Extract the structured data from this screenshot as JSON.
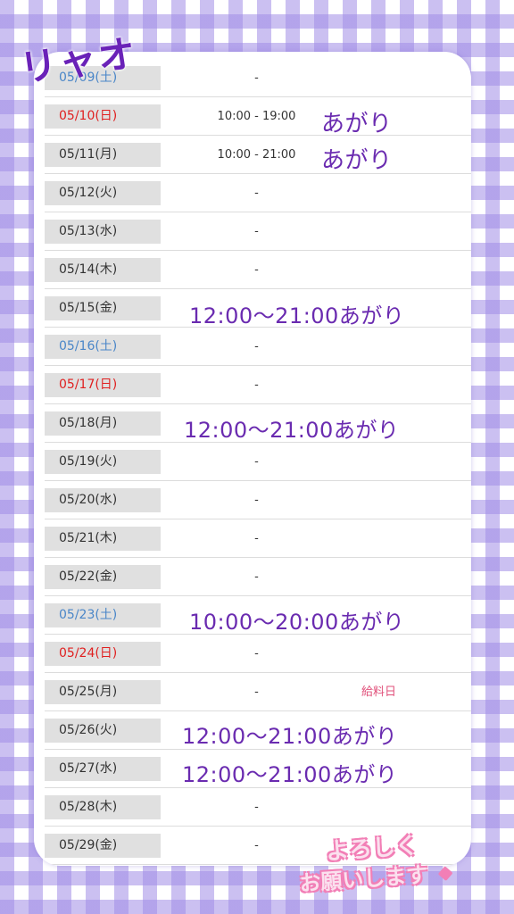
{
  "name_label": "リャオ",
  "schedule": [
    {
      "date": "05/09(土)",
      "day_type": "sat",
      "time": "-",
      "note": ""
    },
    {
      "date": "05/10(日)",
      "day_type": "sun",
      "time": "10:00 - 19:00",
      "note": ""
    },
    {
      "date": "05/11(月)",
      "day_type": "weekday",
      "time": "10:00 - 21:00",
      "note": ""
    },
    {
      "date": "05/12(火)",
      "day_type": "weekday",
      "time": "-",
      "note": ""
    },
    {
      "date": "05/13(水)",
      "day_type": "weekday",
      "time": "-",
      "note": ""
    },
    {
      "date": "05/14(木)",
      "day_type": "weekday",
      "time": "-",
      "note": ""
    },
    {
      "date": "05/15(金)",
      "day_type": "weekday",
      "time": "",
      "note": ""
    },
    {
      "date": "05/16(土)",
      "day_type": "sat",
      "time": "-",
      "note": ""
    },
    {
      "date": "05/17(日)",
      "day_type": "sun",
      "time": "-",
      "note": ""
    },
    {
      "date": "05/18(月)",
      "day_type": "weekday",
      "time": "",
      "note": ""
    },
    {
      "date": "05/19(火)",
      "day_type": "weekday",
      "time": "-",
      "note": ""
    },
    {
      "date": "05/20(水)",
      "day_type": "weekday",
      "time": "-",
      "note": ""
    },
    {
      "date": "05/21(木)",
      "day_type": "weekday",
      "time": "-",
      "note": ""
    },
    {
      "date": "05/22(金)",
      "day_type": "weekday",
      "time": "-",
      "note": ""
    },
    {
      "date": "05/23(土)",
      "day_type": "sat",
      "time": "",
      "note": ""
    },
    {
      "date": "05/24(日)",
      "day_type": "sun",
      "time": "-",
      "note": ""
    },
    {
      "date": "05/25(月)",
      "day_type": "weekday",
      "time": "-",
      "note": "給料日"
    },
    {
      "date": "05/26(火)",
      "day_type": "weekday",
      "time": "",
      "note": ""
    },
    {
      "date": "05/27(水)",
      "day_type": "weekday",
      "time": "",
      "note": ""
    },
    {
      "date": "05/28(木)",
      "day_type": "weekday",
      "time": "-",
      "note": ""
    },
    {
      "date": "05/29(金)",
      "day_type": "weekday",
      "time": "-",
      "note": ""
    }
  ],
  "overlays": {
    "r0510": "あがり",
    "r0511": "あがり",
    "r0515": "12:00〜21:00あがり",
    "r0518": "12:00〜21:00あがり",
    "r0523": "10:00〜20:00あがり",
    "r0526": "12:00〜21:00あがり",
    "r0527": "12:00〜21:00あがり"
  },
  "sticker": {
    "line1": "よろしく",
    "line2": "お願いします"
  },
  "colors": {
    "check_pattern": "#a08ce6",
    "overlay_text": "#6a2bb0",
    "saturday": "#4a86c8",
    "sunday": "#e02020",
    "note": "#e0507a",
    "sticker_outline": "#f27fb6"
  }
}
